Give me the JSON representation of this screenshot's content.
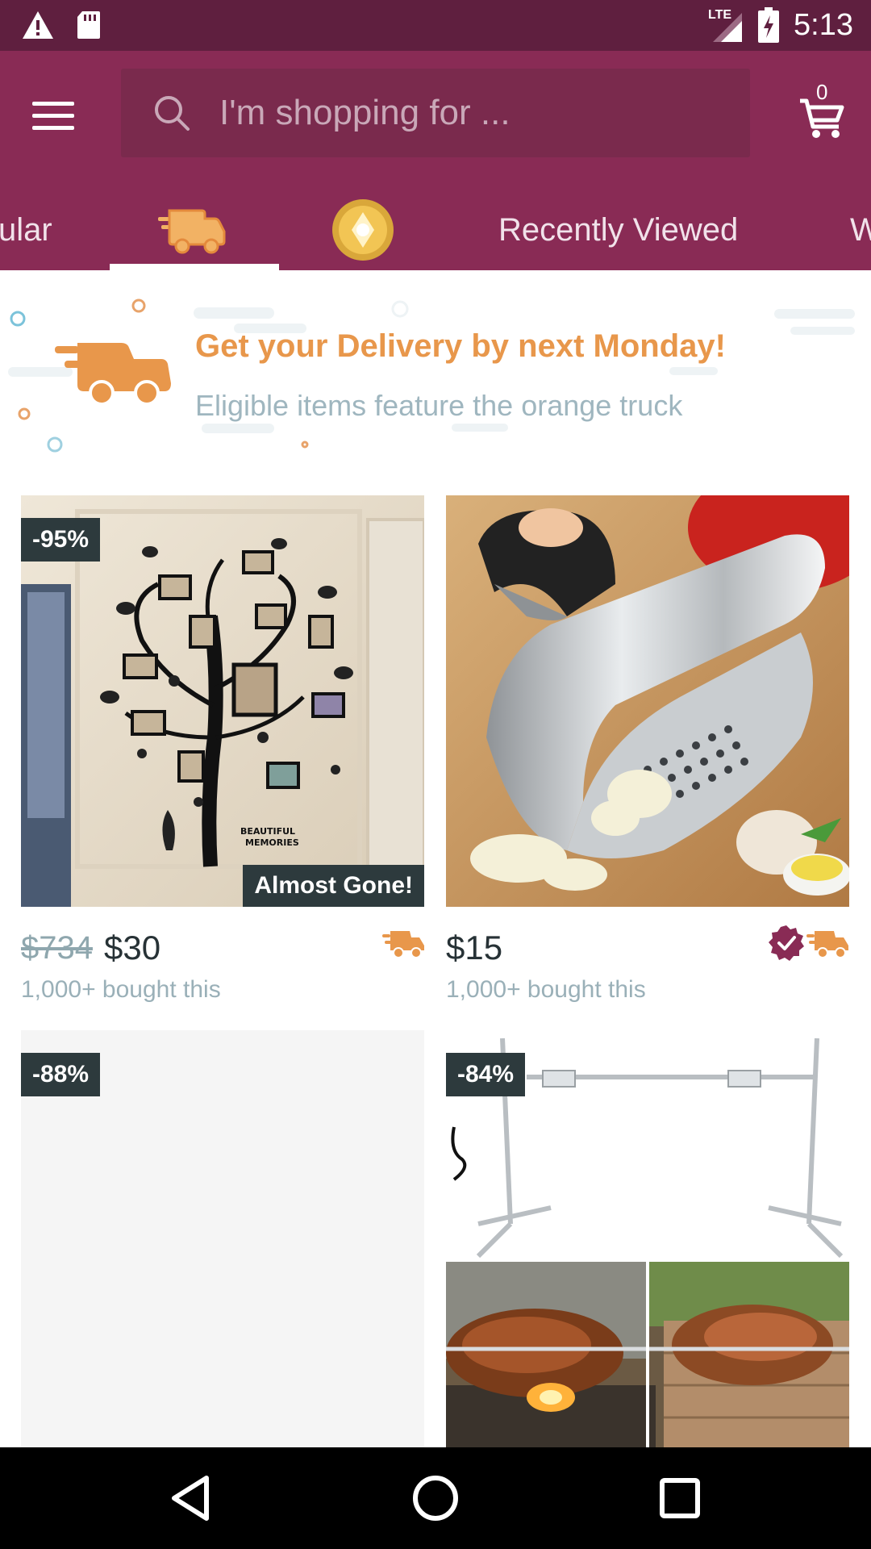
{
  "status_bar": {
    "time": "5:13",
    "network": "LTE",
    "icons": [
      "alert-icon",
      "sd-card-icon",
      "signal-icon",
      "battery-charging-icon"
    ]
  },
  "header": {
    "search_placeholder": "I'm shopping for ...",
    "cart_count": "0"
  },
  "tabs": [
    {
      "label": "ular",
      "kind": "text"
    },
    {
      "label": "",
      "kind": "icon",
      "icon": "delivery-truck-icon",
      "selected": true
    },
    {
      "label": "",
      "kind": "icon",
      "icon": "coin-icon"
    },
    {
      "label": "Recently Viewed",
      "kind": "text"
    },
    {
      "label": "W",
      "kind": "text"
    }
  ],
  "banner": {
    "title": "Get your Delivery by next Monday!",
    "subtitle": "Eligible items feature the orange truck"
  },
  "products": [
    {
      "discount": "-95%",
      "stock_label": "Almost Gone!",
      "old_price": "$734",
      "price": "$30",
      "bought": "1,000+ bought this",
      "image": "family-tree-wall-decal"
    },
    {
      "discount": "",
      "old_price": "",
      "price": "$15",
      "bought": "1,000+ bought this",
      "verified": true,
      "image": "garlic-press-rocker"
    },
    {
      "discount": "-88%",
      "image": "loading-placeholder"
    },
    {
      "discount": "-84%",
      "image": "rotisserie-spit-roaster"
    }
  ],
  "colors": {
    "brand": "#892b55",
    "status_bar": "#5f1f3f",
    "accent_orange": "#e8974b",
    "badge": "#2d3a3d"
  },
  "nav_buttons": [
    "back-icon",
    "home-icon",
    "recents-icon"
  ]
}
